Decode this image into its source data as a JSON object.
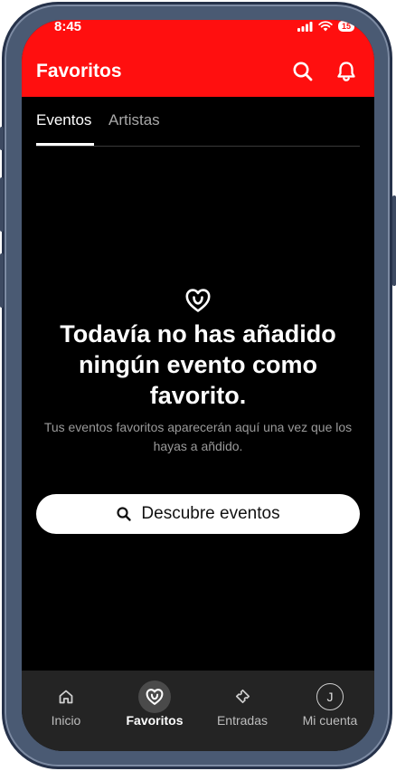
{
  "status_bar": {
    "time": "8:45",
    "battery": "15"
  },
  "header": {
    "title": "Favoritos",
    "search_icon": "search-icon",
    "bell_icon": "bell-icon"
  },
  "tabs": [
    {
      "label": "Eventos",
      "active": true
    },
    {
      "label": "Artistas",
      "active": false
    }
  ],
  "empty_state": {
    "icon": "heart-icon",
    "title": "Todavía no has añadido ningún evento como favorito.",
    "description": "Tus eventos favoritos aparecerán aquí una vez que los hayas a añdido."
  },
  "discover_button": {
    "label": "Descubre eventos",
    "icon": "search-icon"
  },
  "bottom_nav": {
    "items": [
      {
        "label": "Inicio",
        "icon": "home-icon",
        "active": false
      },
      {
        "label": "Favoritos",
        "icon": "heart-icon",
        "active": true
      },
      {
        "label": "Entradas",
        "icon": "ticket-icon",
        "active": false
      },
      {
        "label": "Mi cuenta",
        "icon": "avatar-icon",
        "active": false,
        "avatar_letter": "J"
      }
    ]
  },
  "colors": {
    "brand_red": "#ff0f0f",
    "background": "#000000",
    "nav_background": "#242424"
  }
}
